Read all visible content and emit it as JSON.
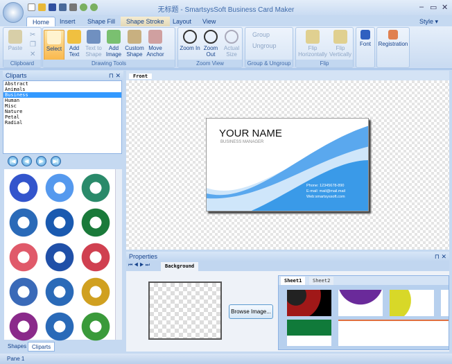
{
  "window": {
    "title": "无标题 - SmartsysSoft Business Card Maker",
    "minimize": "–",
    "maximize": "▭",
    "close": "✕"
  },
  "tabs": [
    "Home",
    "Insert",
    "Shape Fill",
    "Shape Stroke",
    "Layout",
    "View"
  ],
  "style_menu": "Style ▾",
  "ribbon": {
    "clipboard": {
      "label": "Clipboard",
      "paste": "Paste"
    },
    "drawing": {
      "label": "Drawing Tools",
      "buttons": [
        "Select",
        "Add Text",
        "Text to Shape",
        "Add Image",
        "Custom Shape",
        "Move Anchor"
      ]
    },
    "zoom": {
      "label": "Zoom View",
      "buttons": [
        "Zoom In",
        "Zoom Out",
        "Actual Size"
      ]
    },
    "group": {
      "label": "Group & Ungroup",
      "group": "Group",
      "ungroup": "Ungroup"
    },
    "flip": {
      "label": "Flip",
      "buttons": [
        "Flip Horizontally",
        "Flip Vertically"
      ]
    },
    "font": "Font",
    "registration": "Registration"
  },
  "cliparts": {
    "title": "Cliparts",
    "categories": [
      "Abstract",
      "Animals",
      "Business",
      "Human",
      "Misc",
      "Nature",
      "Petal",
      "Radial"
    ],
    "selected": "Business",
    "colors": [
      "#3355cc",
      "#5599ee",
      "#2a8a6a",
      "#2a6ab8",
      "#1a5ab0",
      "#1a7a3a",
      "#e05a6a",
      "#2050a8",
      "#d04050",
      "#3a6ab8",
      "#2a6ab8",
      "#d0a020",
      "#8a2a8a",
      "#2a6ab8",
      "#3a9a3a"
    ]
  },
  "bottom_tabs": [
    "Shapes",
    "Cliparts"
  ],
  "status": "Pane 1",
  "document": {
    "tab": "Front"
  },
  "card": {
    "name": "YOUR NAME",
    "title": "BUSINESS MANAGER",
    "phone": "Phone: 12345678-890",
    "email": "E-mail: mail@mail.mail",
    "web": "Web:smartsyssoft.com"
  },
  "properties": {
    "title": "Properties",
    "tab": "Background",
    "browse": "Browse Image...",
    "sheets": [
      "Sheet1",
      "Sheet2"
    ]
  }
}
